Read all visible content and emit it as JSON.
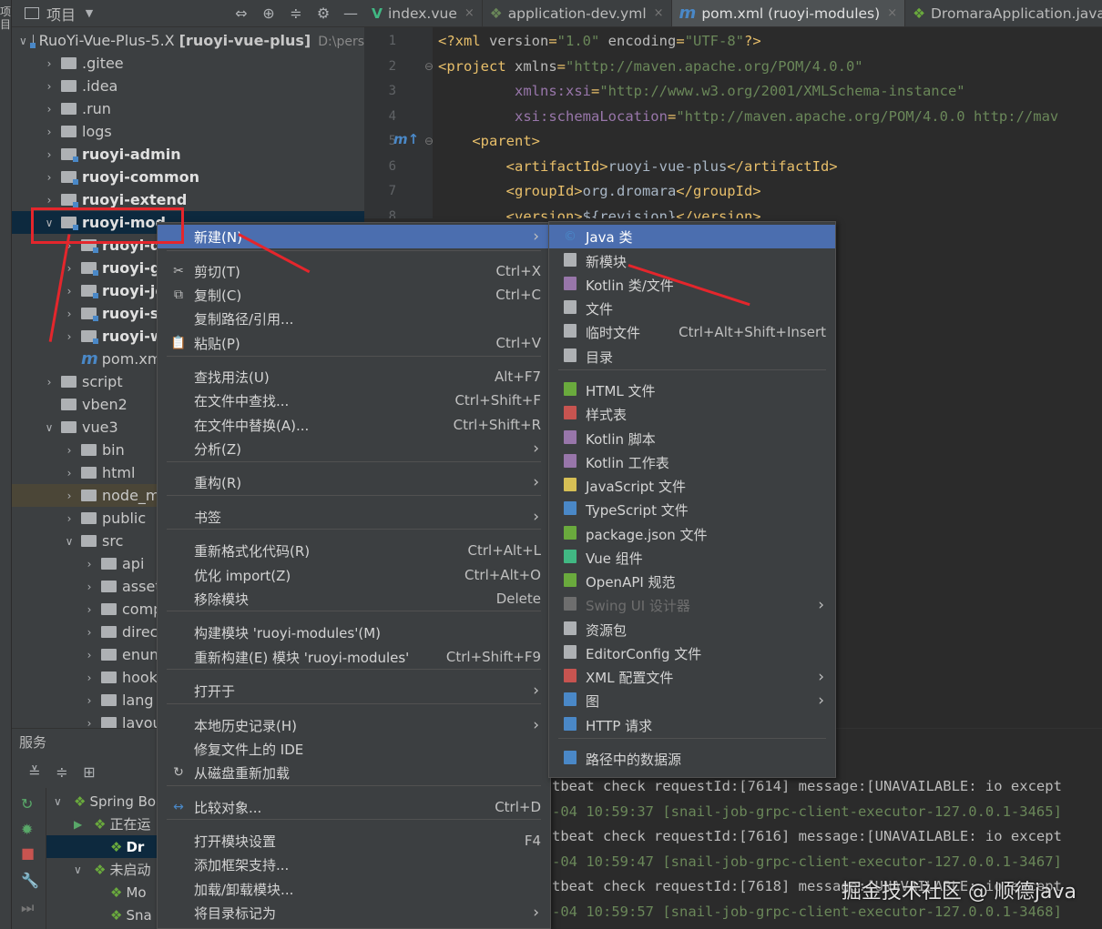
{
  "project_toolbar": {
    "title": "项目"
  },
  "tree": {
    "root": {
      "name": "RuoYi-Vue-Plus-5.X",
      "module": "[ruoyi-vue-plus]",
      "path": "D:\\pers"
    },
    "items": [
      {
        "label": ".gitee",
        "bold": false
      },
      {
        "label": ".idea",
        "bold": false
      },
      {
        "label": ".run",
        "bold": false
      },
      {
        "label": "logs",
        "bold": false
      },
      {
        "label": "ruoyi-admin",
        "bold": true
      },
      {
        "label": "ruoyi-common",
        "bold": true
      },
      {
        "label": "ruoyi-extend",
        "bold": true
      },
      {
        "label": "ruoyi-mod",
        "bold": true
      },
      {
        "label": "ruoyi-d",
        "bold": true
      },
      {
        "label": "ruoyi-g",
        "bold": true
      },
      {
        "label": "ruoyi-jo",
        "bold": true
      },
      {
        "label": "ruoyi-sy",
        "bold": true
      },
      {
        "label": "ruoyi-w",
        "bold": true
      },
      {
        "label": "pom.xm",
        "bold": false
      },
      {
        "label": "script",
        "bold": false
      },
      {
        "label": "vben2",
        "bold": false
      },
      {
        "label": "vue3",
        "bold": false
      },
      {
        "label": "bin",
        "bold": false
      },
      {
        "label": "html",
        "bold": false
      },
      {
        "label": "node_m",
        "bold": false
      },
      {
        "label": "public",
        "bold": false
      },
      {
        "label": "src",
        "bold": false
      },
      {
        "label": "api",
        "bold": false
      },
      {
        "label": "asset",
        "bold": false
      },
      {
        "label": "comp",
        "bold": false
      },
      {
        "label": "direc",
        "bold": false
      },
      {
        "label": "enum",
        "bold": false
      },
      {
        "label": "hook",
        "bold": false
      },
      {
        "label": "lang",
        "bold": false
      },
      {
        "label": "layou",
        "bold": false
      }
    ]
  },
  "services": {
    "title": "服务",
    "items": [
      "Spring Bo",
      "正在运",
      "Dr",
      "未启动",
      "Mo",
      "Sna"
    ]
  },
  "tabs": [
    {
      "label": "index.vue",
      "icon": "vue-icon",
      "color": "#41b883"
    },
    {
      "label": "application-dev.yml",
      "icon": "yml-icon",
      "color": "#6a8759"
    },
    {
      "label": "pom.xml (ruoyi-modules)",
      "icon": "maven-icon",
      "color": "#4a88c7"
    },
    {
      "label": "DromaraApplication.java",
      "icon": "spring-icon",
      "color": "#6aaa3d"
    }
  ],
  "editor": {
    "lines": [
      "1",
      "2",
      "3",
      "4",
      "5",
      "6",
      "7",
      "8"
    ],
    "code": [
      {
        "a": "<?xml ",
        "b": "version",
        "c": "=",
        "d": "\"1.0\"",
        "e": " encoding",
        "f": "=",
        "g": "\"UTF-8\"",
        "h": "?>"
      },
      {
        "a": "<project ",
        "b": "xmlns",
        "c": "=",
        "d": "\"http://maven.apache.org/POM/4.0.0\""
      },
      {
        "a": "         ",
        "b": "xmlns:xsi",
        "c": "=",
        "d": "\"http://www.w3.org/2001/XMLSchema-instance\""
      },
      {
        "a": "         ",
        "b": "xsi:schemaLocation",
        "c": "=",
        "d": "\"http://maven.apache.org/POM/4.0.0 http://mav"
      },
      {
        "a": "    <parent>"
      },
      {
        "a": "        <artifactId>",
        "b": "ruoyi-vue-plus",
        "c": "</artifactId>"
      },
      {
        "a": "        <groupId>",
        "b": "org.dromara",
        "c": "</groupId>"
      },
      {
        "a": "        <version>",
        "b": "${revision}",
        "c": "</version>"
      }
    ]
  },
  "console": {
    "lines": [
      {
        "a": "tbeat check requestId:[7614] message:[UNAVAILABLE: io except"
      },
      {
        "a": "-04 10:59:37 ",
        "b": "[snail-job-grpc-client-executor-127.0.0.1-3465]"
      },
      {
        "a": "tbeat check requestId:[7616] message:[UNAVAILABLE: io except"
      },
      {
        "a": "-04 10:59:47 ",
        "b": "[snail-job-grpc-client-executor-127.0.0.1-3467]"
      },
      {
        "a": "tbeat check requestId:[7618] message:[UNAVAILABLE: io except"
      },
      {
        "a": "-04 10:59:57 ",
        "b": "[snail-job-grpc-client-executor-127.0.0.1-3468]"
      }
    ],
    "watermark": "掘金技术社区 @ 顺德java"
  },
  "context_menu": [
    {
      "label": "新建(N)",
      "shortcut": "",
      "sub": true,
      "icon": ""
    },
    {
      "label": "剪切(T)",
      "shortcut": "Ctrl+X",
      "icon": "✂"
    },
    {
      "label": "复制(C)",
      "shortcut": "Ctrl+C",
      "icon": "⧉"
    },
    {
      "label": "复制路径/引用...",
      "shortcut": "",
      "icon": ""
    },
    {
      "label": "粘贴(P)",
      "shortcut": "Ctrl+V",
      "icon": "📋"
    },
    {
      "label": "查找用法(U)",
      "shortcut": "Alt+F7",
      "icon": ""
    },
    {
      "label": "在文件中查找...",
      "shortcut": "Ctrl+Shift+F",
      "icon": ""
    },
    {
      "label": "在文件中替换(A)...",
      "shortcut": "Ctrl+Shift+R",
      "icon": ""
    },
    {
      "label": "分析(Z)",
      "shortcut": "",
      "sub": true,
      "icon": ""
    },
    {
      "label": "重构(R)",
      "shortcut": "",
      "sub": true,
      "icon": ""
    },
    {
      "label": "书签",
      "shortcut": "",
      "sub": true,
      "icon": ""
    },
    {
      "label": "重新格式化代码(R)",
      "shortcut": "Ctrl+Alt+L",
      "icon": ""
    },
    {
      "label": "优化 import(Z)",
      "shortcut": "Ctrl+Alt+O",
      "icon": ""
    },
    {
      "label": "移除模块",
      "shortcut": "Delete",
      "icon": ""
    },
    {
      "label": "构建模块 'ruoyi-modules'(M)",
      "shortcut": "",
      "icon": ""
    },
    {
      "label": "重新构建(E) 模块 'ruoyi-modules'",
      "shortcut": "Ctrl+Shift+F9",
      "icon": ""
    },
    {
      "label": "打开于",
      "shortcut": "",
      "sub": true,
      "icon": ""
    },
    {
      "label": "本地历史记录(H)",
      "shortcut": "",
      "sub": true,
      "icon": ""
    },
    {
      "label": "修复文件上的 IDE",
      "shortcut": "",
      "icon": ""
    },
    {
      "label": "从磁盘重新加载",
      "shortcut": "",
      "icon": "↻"
    },
    {
      "label": "比较对象...",
      "shortcut": "Ctrl+D",
      "icon": "↔"
    },
    {
      "label": "打开模块设置",
      "shortcut": "F4",
      "icon": ""
    },
    {
      "label": "添加框架支持...",
      "shortcut": "",
      "icon": ""
    },
    {
      "label": "加载/卸载模块...",
      "shortcut": "",
      "icon": ""
    },
    {
      "label": "将目录标记为",
      "shortcut": "",
      "sub": true,
      "icon": ""
    }
  ],
  "new_menu": [
    {
      "label": "Java 类",
      "shortcut": "",
      "color": "#4a88c7"
    },
    {
      "label": "新模块",
      "shortcut": "",
      "color": "#aeb1b4"
    },
    {
      "label": "Kotlin 类/文件",
      "shortcut": "",
      "color": "#9876aa"
    },
    {
      "label": "文件",
      "shortcut": "",
      "color": "#aeb1b4"
    },
    {
      "label": "临时文件",
      "shortcut": "Ctrl+Alt+Shift+Insert",
      "color": "#aeb1b4"
    },
    {
      "label": "目录",
      "shortcut": "",
      "color": "#aeb1b4"
    },
    {
      "label": "HTML 文件",
      "shortcut": "",
      "color": "#6aaa3d"
    },
    {
      "label": "样式表",
      "shortcut": "",
      "color": "#c75450"
    },
    {
      "label": "Kotlin 脚本",
      "shortcut": "",
      "color": "#9876aa"
    },
    {
      "label": "Kotlin 工作表",
      "shortcut": "",
      "color": "#9876aa"
    },
    {
      "label": "JavaScript 文件",
      "shortcut": "",
      "color": "#d6bf55"
    },
    {
      "label": "TypeScript 文件",
      "shortcut": "",
      "color": "#4a88c7"
    },
    {
      "label": "package.json 文件",
      "shortcut": "",
      "color": "#6aaa3d"
    },
    {
      "label": "Vue 组件",
      "shortcut": "",
      "color": "#41b883"
    },
    {
      "label": "OpenAPI 规范",
      "shortcut": "",
      "color": "#6aaa3d"
    },
    {
      "label": "Swing UI 设计器",
      "shortcut": "",
      "color": "#6e6e6e"
    },
    {
      "label": "资源包",
      "shortcut": "",
      "color": "#aeb1b4"
    },
    {
      "label": "EditorConfig 文件",
      "shortcut": "",
      "color": "#aeb1b4"
    },
    {
      "label": "XML 配置文件",
      "shortcut": "",
      "color": "#c75450"
    },
    {
      "label": "图",
      "shortcut": "",
      "color": "#4a88c7"
    },
    {
      "label": "HTTP 请求",
      "shortcut": "",
      "color": "#4a88c7"
    },
    {
      "label": "路径中的数据源",
      "shortcut": "",
      "color": "#4a88c7"
    }
  ]
}
